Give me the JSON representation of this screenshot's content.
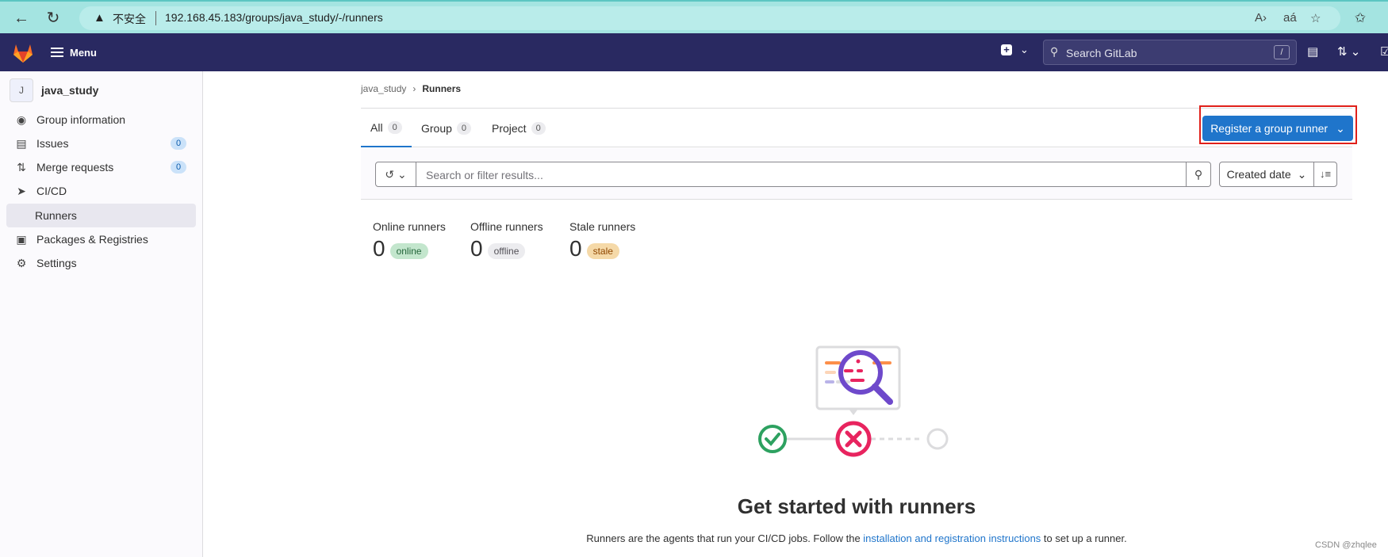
{
  "browser": {
    "insecure_label": "不安全",
    "url": "192.168.45.183/groups/java_study/-/runners"
  },
  "header": {
    "menu_label": "Menu",
    "search_placeholder": "Search GitLab",
    "search_shortcut": "/"
  },
  "sidebar": {
    "context_avatar": "J",
    "context_name": "java_study",
    "items": [
      {
        "label": "Group information",
        "icon": "group-icon"
      },
      {
        "label": "Issues",
        "icon": "issues-icon",
        "badge": "0"
      },
      {
        "label": "Merge requests",
        "icon": "merge-request-icon",
        "badge": "0"
      },
      {
        "label": "CI/CD",
        "icon": "rocket-icon"
      },
      {
        "label": "Runners",
        "sub": true,
        "active": true
      },
      {
        "label": "Packages & Registries",
        "icon": "package-icon"
      },
      {
        "label": "Settings",
        "icon": "settings-icon"
      }
    ]
  },
  "breadcrumb": {
    "parent": "java_study",
    "current": "Runners"
  },
  "tabs": [
    {
      "label": "All",
      "count": "0",
      "active": true
    },
    {
      "label": "Group",
      "count": "0"
    },
    {
      "label": "Project",
      "count": "0"
    }
  ],
  "register_button": "Register a group runner",
  "filter": {
    "placeholder": "Search or filter results...",
    "sort_label": "Created date"
  },
  "stats": [
    {
      "label": "Online runners",
      "value": "0",
      "badge": "online",
      "badge_bg": "#c3e6cd",
      "badge_fg": "#24663b"
    },
    {
      "label": "Offline runners",
      "value": "0",
      "badge": "offline",
      "badge_bg": "#ececef",
      "badge_fg": "#535158"
    },
    {
      "label": "Stale runners",
      "value": "0",
      "badge": "stale",
      "badge_bg": "#f5d9a8",
      "badge_fg": "#8f4700"
    }
  ],
  "empty_state": {
    "title": "Get started with runners",
    "desc_before": "Runners are the agents that run your CI/CD jobs. Follow the ",
    "desc_link": "installation and registration instructions",
    "desc_after": " to set up a runner."
  },
  "watermark": "CSDN @zhqlee",
  "colors": {
    "header_bg": "#292961",
    "primary": "#1f75cb",
    "highlight": "#e0201a"
  }
}
